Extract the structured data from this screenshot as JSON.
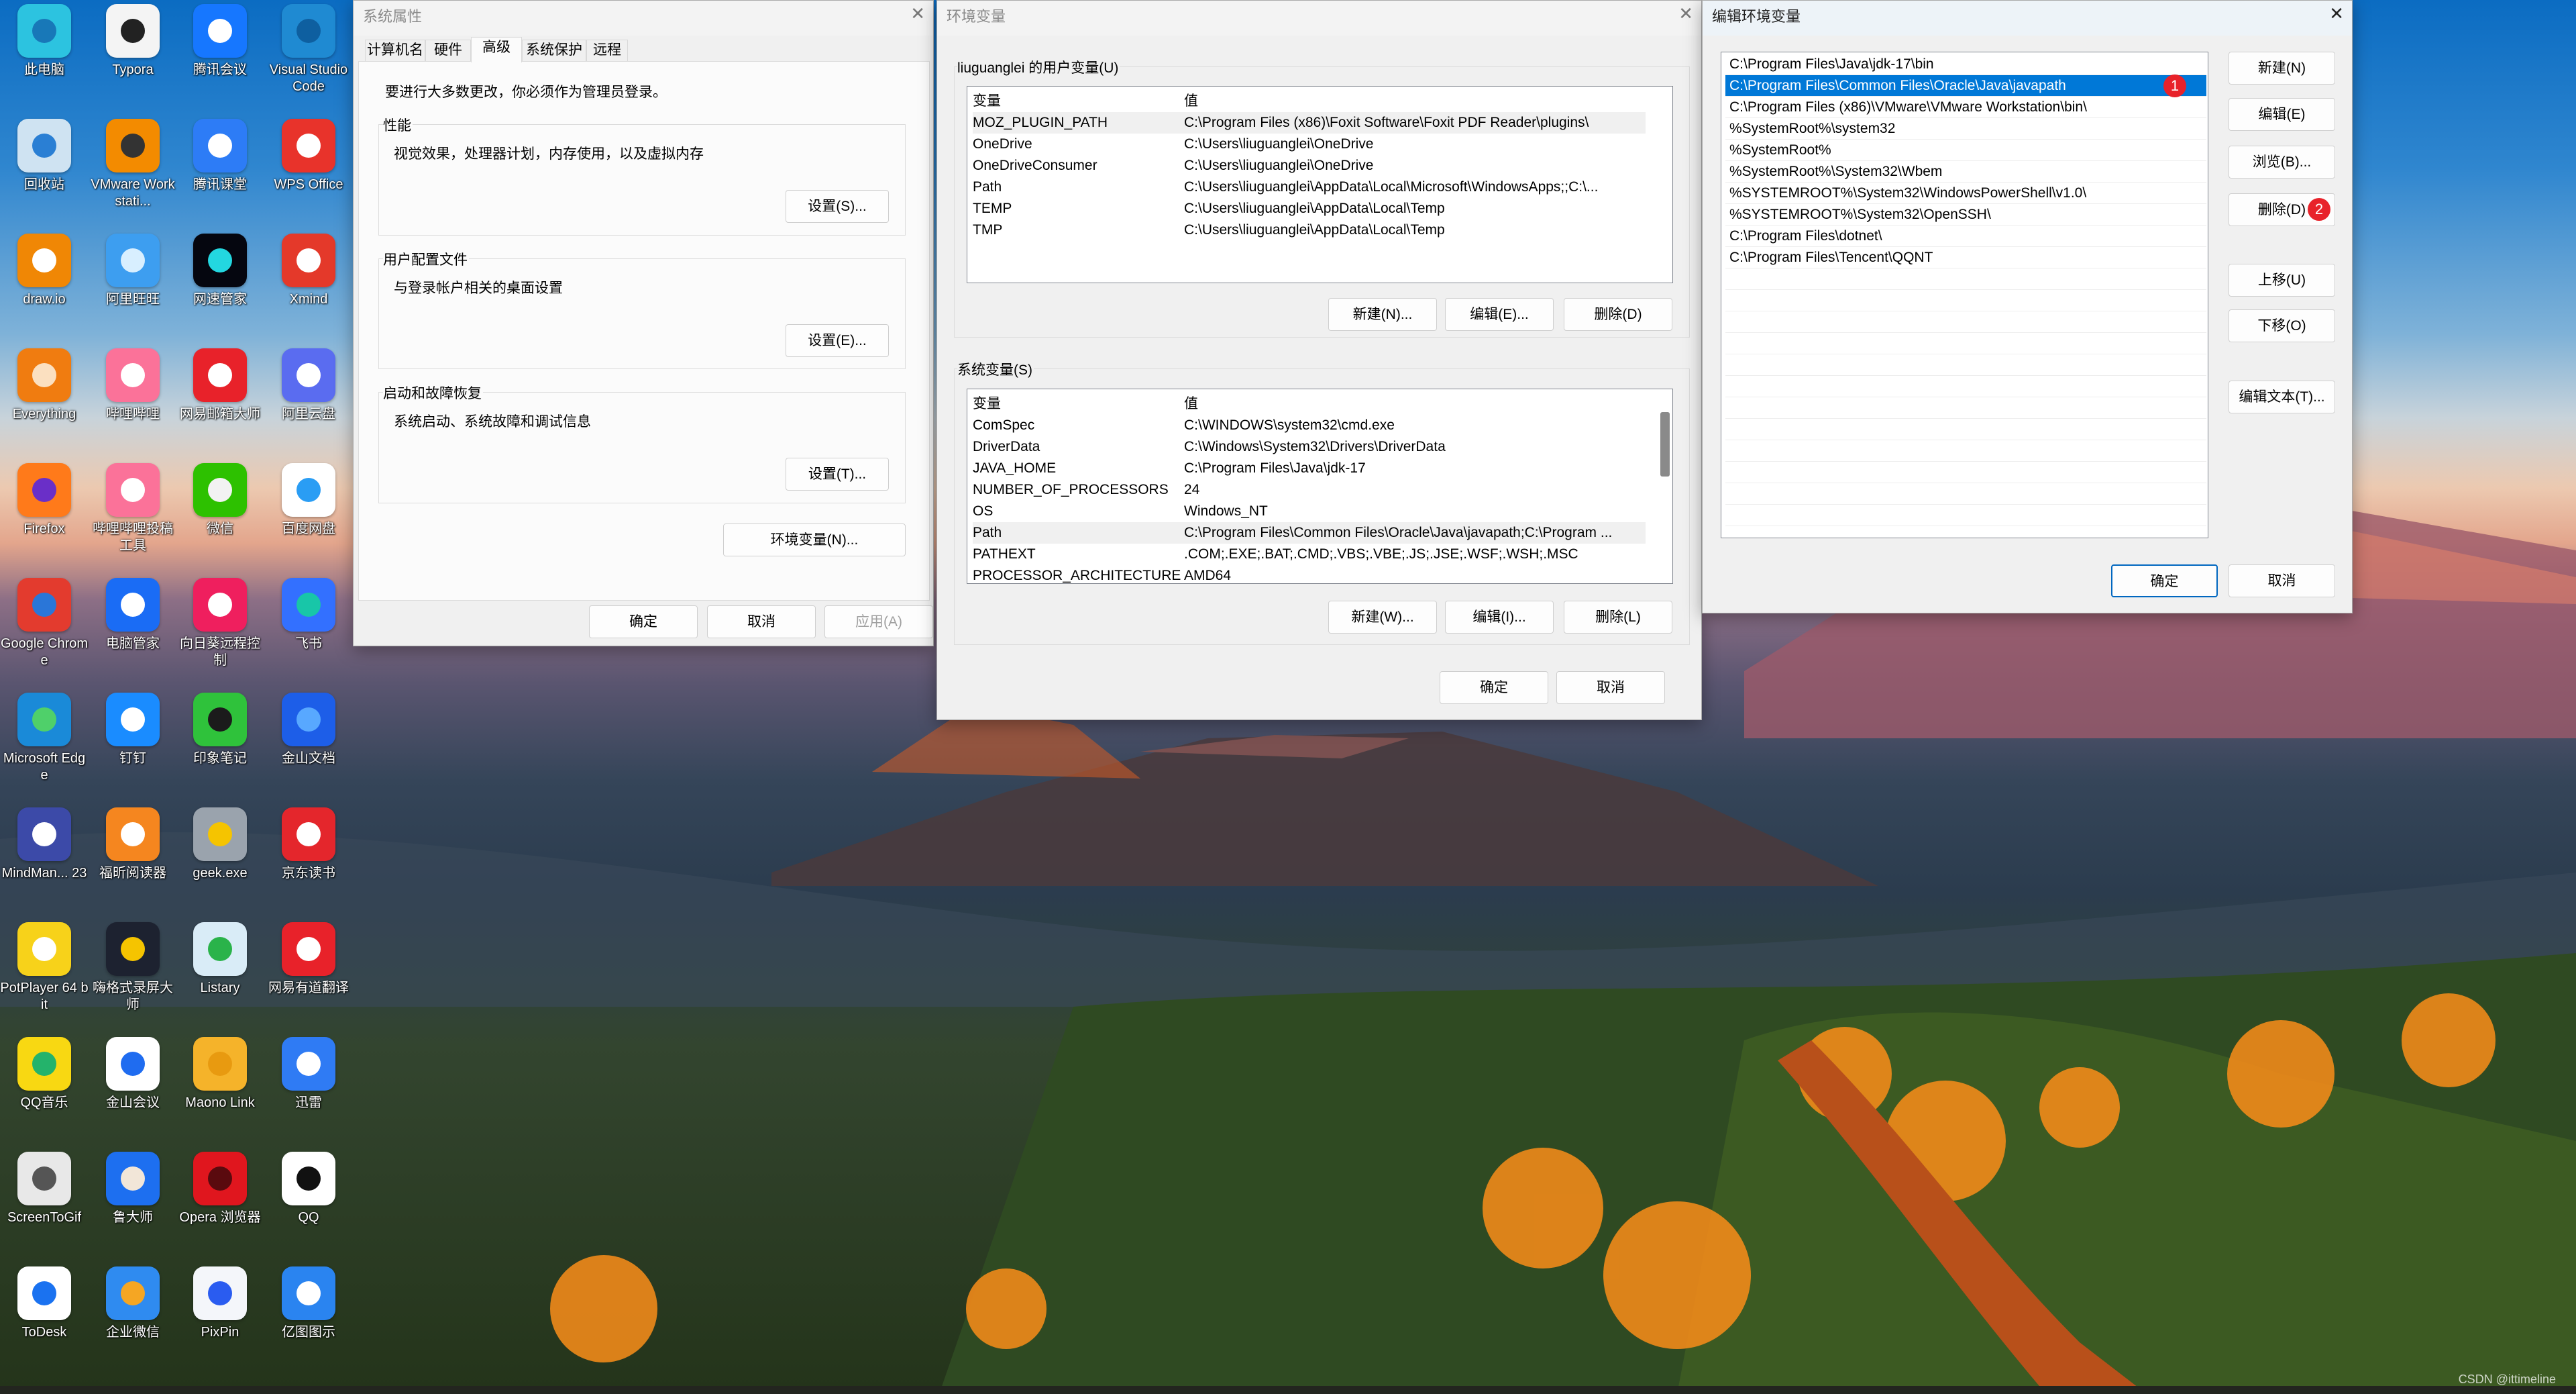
{
  "desktop_icons": [
    {
      "label": "此电脑",
      "icon": "computer-icon",
      "color": "#2cc3e0",
      "accent": "#1878b8"
    },
    {
      "label": "Typora",
      "icon": "typora-icon",
      "color": "#f4f4f4",
      "accent": "#222222"
    },
    {
      "label": "腾讯会议",
      "icon": "tencent-meeting-icon",
      "color": "#1677ff",
      "accent": "#ffffff"
    },
    {
      "label": "Visual Studio Code",
      "icon": "vscode-icon",
      "color": "#1f8ad2",
      "accent": "#0e5fa0"
    },
    {
      "label": "回收站",
      "icon": "recycle-bin-icon",
      "color": "#cfe3f2",
      "accent": "#2a7fd4"
    },
    {
      "label": "VMware Workstati...",
      "icon": "vmware-icon",
      "color": "#f38b00",
      "accent": "#333333"
    },
    {
      "label": "腾讯课堂",
      "icon": "tencent-classroom-icon",
      "color": "#2d7cf6",
      "accent": "#ffffff"
    },
    {
      "label": "WPS Office",
      "icon": "wps-icon",
      "color": "#e8332b",
      "accent": "#ffffff"
    },
    {
      "label": "draw.io",
      "icon": "drawio-icon",
      "color": "#f08705",
      "accent": "#ffffff"
    },
    {
      "label": "阿里旺旺",
      "icon": "aliwangwang-icon",
      "color": "#3d9ef0",
      "accent": "#d8efff"
    },
    {
      "label": "网速管家",
      "icon": "network-speed-icon",
      "color": "#05060f",
      "accent": "#23d7e0"
    },
    {
      "label": "Xmind",
      "icon": "xmind-icon",
      "color": "#e4392a",
      "accent": "#ffffff"
    },
    {
      "label": "Everything",
      "icon": "everything-icon",
      "color": "#f07c10",
      "accent": "#fbe0c0"
    },
    {
      "label": "哔哩哔哩",
      "icon": "bilibili-icon",
      "color": "#fb7299",
      "accent": "#ffffff"
    },
    {
      "label": "网易邮箱大师",
      "icon": "netease-mail-icon",
      "color": "#e8222a",
      "accent": "#ffffff"
    },
    {
      "label": "阿里云盘",
      "icon": "aliyun-drive-icon",
      "color": "#5a6cf0",
      "accent": "#ffffff"
    },
    {
      "label": "Firefox",
      "icon": "firefox-icon",
      "color": "#ff7a1a",
      "accent": "#6a2fc8"
    },
    {
      "label": "哔哩哔哩投稿工具",
      "icon": "bilibili-upload-icon",
      "color": "#fb7299",
      "accent": "#ffffff"
    },
    {
      "label": "微信",
      "icon": "wechat-icon",
      "color": "#2dc100",
      "accent": "#f2f2f2"
    },
    {
      "label": "百度网盘",
      "icon": "baidu-netdisk-icon",
      "color": "#ffffff",
      "accent": "#2a9df4"
    },
    {
      "label": "Google Chrome",
      "icon": "chrome-icon",
      "color": "#e33b2e",
      "accent": "#2a76d8"
    },
    {
      "label": "电脑管家",
      "icon": "pc-manager-icon",
      "color": "#1a6cf5",
      "accent": "#ffffff"
    },
    {
      "label": "向日葵远程控制",
      "icon": "sunlogin-icon",
      "color": "#ef1f5e",
      "accent": "#ffffff"
    },
    {
      "label": "飞书",
      "icon": "feishu-icon",
      "color": "#3370ff",
      "accent": "#18c6a8"
    },
    {
      "label": "Microsoft Edge",
      "icon": "edge-icon",
      "color": "#1a8ad8",
      "accent": "#4fd06a"
    },
    {
      "label": "钉钉",
      "icon": "dingtalk-icon",
      "color": "#1a8cff",
      "accent": "#ffffff"
    },
    {
      "label": "印象笔记",
      "icon": "evernote-icon",
      "color": "#2fc23b",
      "accent": "#1b1b1b"
    },
    {
      "label": "金山文档",
      "icon": "kdocs-icon",
      "color": "#1d5ee8",
      "accent": "#58a8ff"
    },
    {
      "label": "MindMan... 23",
      "icon": "mindmanager-icon",
      "color": "#3c4aa8",
      "accent": "#ffffff"
    },
    {
      "label": "福昕阅读器",
      "icon": "foxit-reader-icon",
      "color": "#f5861f",
      "accent": "#ffffff"
    },
    {
      "label": "geek.exe",
      "icon": "geek-uninstaller-icon",
      "color": "#9aa3ad",
      "accent": "#f5c400"
    },
    {
      "label": "京东读书",
      "icon": "jd-read-icon",
      "color": "#e4262c",
      "accent": "#ffffff"
    },
    {
      "label": "PotPlayer 64 bit",
      "icon": "potplayer-icon",
      "color": "#f7d21a",
      "accent": "#ffffff"
    },
    {
      "label": "嗨格式录屏大师",
      "icon": "screen-recorder-icon",
      "color": "#1d2230",
      "accent": "#f5c400"
    },
    {
      "label": "Listary",
      "icon": "listary-icon",
      "color": "#d9ecf7",
      "accent": "#2ab34a"
    },
    {
      "label": "网易有道翻译",
      "icon": "youdao-icon",
      "color": "#e8222a",
      "accent": "#ffffff"
    },
    {
      "label": "QQ音乐",
      "icon": "qq-music-icon",
      "color": "#f8d812",
      "accent": "#24b36b"
    },
    {
      "label": "金山会议",
      "icon": "kmeeting-icon",
      "color": "#ffffff",
      "accent": "#1f6cf0"
    },
    {
      "label": "Maono Link",
      "icon": "maono-link-icon",
      "color": "#f5b32a",
      "accent": "#e89a10"
    },
    {
      "label": "迅雷",
      "icon": "xunlei-icon",
      "color": "#2f7bf4",
      "accent": "#ffffff"
    },
    {
      "label": "ScreenToGif",
      "icon": "screentogif-icon",
      "color": "#e8e8e8",
      "accent": "#555555"
    },
    {
      "label": "鲁大师",
      "icon": "ludashi-icon",
      "color": "#1d6ff0",
      "accent": "#f2e6d8"
    },
    {
      "label": "Opera 浏览器",
      "icon": "opera-icon",
      "color": "#e0161e",
      "accent": "#5a0a0e"
    },
    {
      "label": "QQ",
      "icon": "qq-icon",
      "color": "#ffffff",
      "accent": "#111111"
    },
    {
      "label": "ToDesk",
      "icon": "todesk-icon",
      "color": "#ffffff",
      "accent": "#1a72f0"
    },
    {
      "label": "企业微信",
      "icon": "wecom-icon",
      "color": "#2f8bf0",
      "accent": "#f5a623"
    },
    {
      "label": "PixPin",
      "icon": "pixpin-icon",
      "color": "#f4f6fa",
      "accent": "#2a5cf0"
    },
    {
      "label": "亿图图示",
      "icon": "edraw-icon",
      "color": "#2a84f0",
      "accent": "#ffffff"
    }
  ],
  "system_properties": {
    "title": "系统属性",
    "tabs": [
      {
        "label": "计算机名"
      },
      {
        "label": "硬件"
      },
      {
        "label": "高级"
      },
      {
        "label": "系统保护"
      },
      {
        "label": "远程"
      }
    ],
    "selected_tab": "高级",
    "admin_notice": "要进行大多数更改，你必须作为管理员登录。",
    "groups": [
      {
        "label": "性能",
        "desc": "视觉效果，处理器计划，内存使用，以及虚拟内存",
        "button": "设置(S)..."
      },
      {
        "label": "用户配置文件",
        "desc": "与登录帐户相关的桌面设置",
        "button": "设置(E)..."
      },
      {
        "label": "启动和故障恢复",
        "desc": "系统启动、系统故障和调试信息",
        "button": "设置(T)..."
      }
    ],
    "env_button": "环境变量(N)...",
    "ok": "确定",
    "cancel": "取消",
    "apply": "应用(A)"
  },
  "env_vars": {
    "title": "环境变量",
    "user_group_label": "liuguanglei 的用户变量(U)",
    "col_var": "变量",
    "col_val": "值",
    "user_vars": [
      {
        "name": "MOZ_PLUGIN_PATH",
        "value": "C:\\Program Files (x86)\\Foxit Software\\Foxit PDF Reader\\plugins\\"
      },
      {
        "name": "OneDrive",
        "value": "C:\\Users\\liuguanglei\\OneDrive"
      },
      {
        "name": "OneDriveConsumer",
        "value": "C:\\Users\\liuguanglei\\OneDrive"
      },
      {
        "name": "Path",
        "value": "C:\\Users\\liuguanglei\\AppData\\Local\\Microsoft\\WindowsApps;;C:\\..."
      },
      {
        "name": "TEMP",
        "value": "C:\\Users\\liuguanglei\\AppData\\Local\\Temp"
      },
      {
        "name": "TMP",
        "value": "C:\\Users\\liuguanglei\\AppData\\Local\\Temp"
      }
    ],
    "user_buttons": {
      "new": "新建(N)...",
      "edit": "编辑(E)...",
      "delete": "删除(D)"
    },
    "system_group_label": "系统变量(S)",
    "system_vars": [
      {
        "name": "ComSpec",
        "value": "C:\\WINDOWS\\system32\\cmd.exe"
      },
      {
        "name": "DriverData",
        "value": "C:\\Windows\\System32\\Drivers\\DriverData"
      },
      {
        "name": "JAVA_HOME",
        "value": "C:\\Program Files\\Java\\jdk-17"
      },
      {
        "name": "NUMBER_OF_PROCESSORS",
        "value": "24"
      },
      {
        "name": "OS",
        "value": "Windows_NT"
      },
      {
        "name": "Path",
        "value": "C:\\Program Files\\Common Files\\Oracle\\Java\\javapath;C:\\Program ..."
      },
      {
        "name": "PATHEXT",
        "value": ".COM;.EXE;.BAT;.CMD;.VBS;.VBE;.JS;.JSE;.WSF;.WSH;.MSC"
      },
      {
        "name": "PROCESSOR_ARCHITECTURE",
        "value": "AMD64"
      }
    ],
    "system_buttons": {
      "new": "新建(W)...",
      "edit": "编辑(I)...",
      "delete": "删除(L)"
    },
    "ok": "确定",
    "cancel": "取消"
  },
  "edit_env": {
    "title": "编辑环境变量",
    "entries": [
      "C:\\Program Files\\Java\\jdk-17\\bin",
      "C:\\Program Files\\Common Files\\Oracle\\Java\\javapath",
      "C:\\Program Files (x86)\\VMware\\VMware Workstation\\bin\\",
      "%SystemRoot%\\system32",
      "%SystemRoot%",
      "%SystemRoot%\\System32\\Wbem",
      "%SYSTEMROOT%\\System32\\WindowsPowerShell\\v1.0\\",
      "%SYSTEMROOT%\\System32\\OpenSSH\\",
      "C:\\Program Files\\dotnet\\",
      "C:\\Program Files\\Tencent\\QQNT"
    ],
    "selected_index": 1,
    "badge_1": "1",
    "badge_2": "2",
    "buttons": {
      "new": "新建(N)",
      "edit": "编辑(E)",
      "browse": "浏览(B)...",
      "delete": "删除(D)",
      "up": "上移(U)",
      "down": "下移(O)",
      "edit_text": "编辑文本(T)..."
    },
    "ok": "确定",
    "cancel": "取消"
  },
  "watermark": "CSDN @ittimeline",
  "colors": {
    "selection": "#0078d7",
    "badge": "#e8222a",
    "default_button_border": "#0067c0"
  }
}
